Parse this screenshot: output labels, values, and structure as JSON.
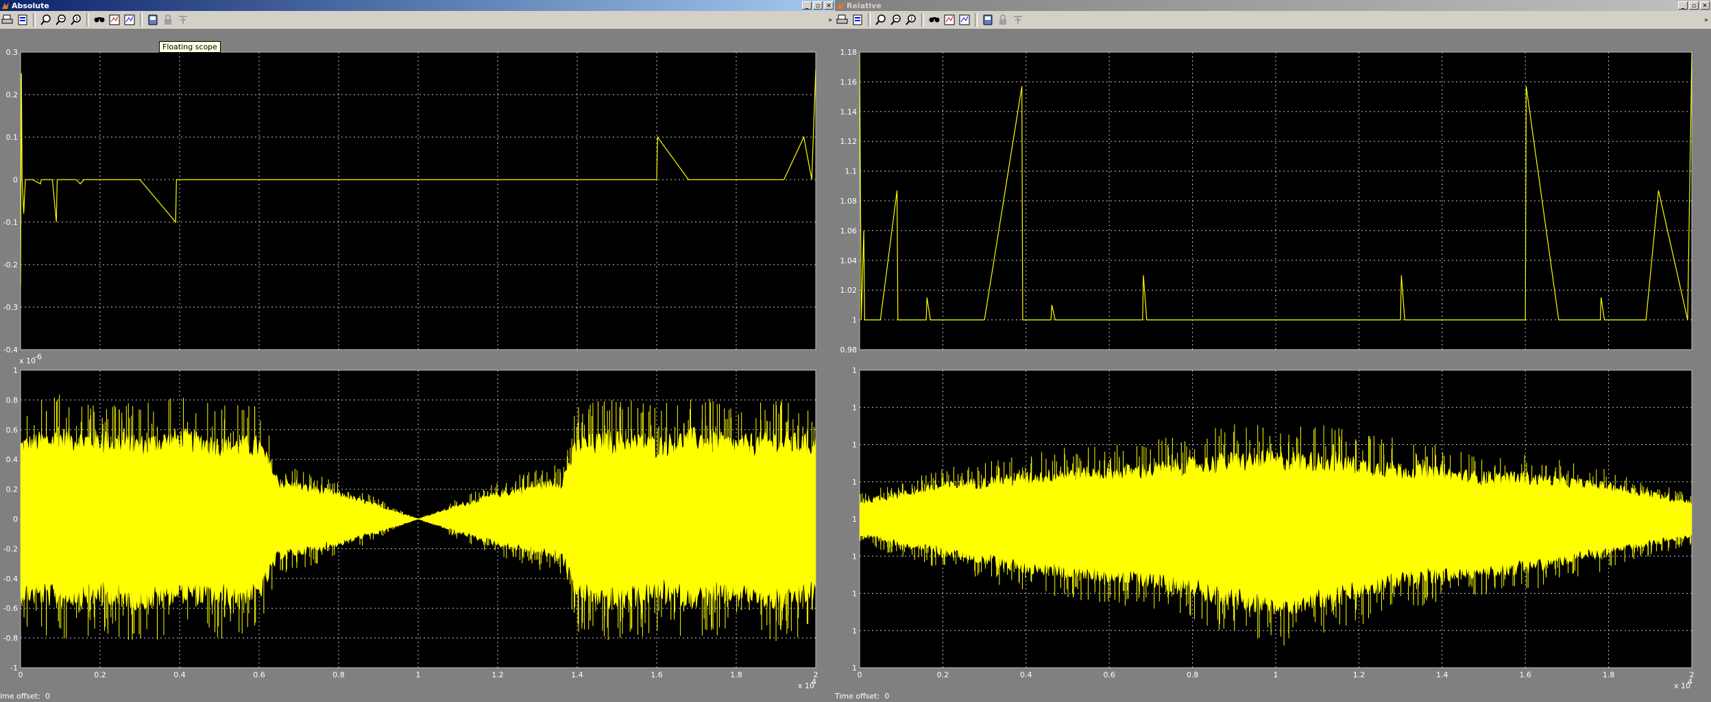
{
  "windows": [
    {
      "title": "Absolute",
      "status_label": "ime offset:",
      "status_value": "0",
      "tooltip": "Floating scope",
      "axes": [
        {
          "yticks": [
            "0.3",
            "0.2",
            "0.1",
            "0",
            "-0.1",
            "-0.2",
            "-0.3",
            "-0.4"
          ],
          "ylim": [
            -0.4,
            0.3
          ],
          "xticks": [],
          "exponent": "",
          "signal_color": "#ffff00",
          "chart_data": {
            "type": "line",
            "xlim": [
              0,
              2
            ],
            "ylim": [
              -0.4,
              0.3
            ],
            "x": [
              0,
              0.002,
              0.004,
              0.008,
              0.012,
              0.02,
              0.03,
              0.05,
              0.052,
              0.06,
              0.08,
              0.09,
              0.092,
              0.1,
              0.14,
              0.15,
              0.16,
              0.3,
              0.39,
              0.392,
              0.4,
              0.46,
              0.7,
              1.3,
              1.6,
              1.602,
              1.68,
              1.7,
              1.92,
              1.97,
              1.99,
              2.0
            ],
            "y": [
              -0.25,
              0.25,
              0,
              -0.08,
              0,
              0,
              0,
              -0.01,
              0,
              0,
              0,
              -0.1,
              0,
              0,
              0,
              -0.01,
              0,
              0,
              -0.1,
              0,
              0,
              0,
              0,
              0,
              0,
              0.1,
              0,
              0,
              0,
              0.1,
              0,
              0.26
            ],
            "grid": true
          }
        },
        {
          "yticks": [
            "1",
            "0.8",
            "0.6",
            "0.4",
            "0.2",
            "0",
            "-0.2",
            "-0.4",
            "-0.6",
            "-0.8",
            "-1"
          ],
          "ylim": [
            -1,
            1
          ],
          "xticks": [
            "0",
            "0.2",
            "0.4",
            "0.6",
            "0.8",
            "1",
            "1.2",
            "1.4",
            "1.6",
            "1.8",
            "2"
          ],
          "exponent": "x 10",
          "exponent_top": "-6",
          "xexp": "4",
          "signal_color": "#ffff00",
          "chart_data": {
            "type": "area",
            "xlim": [
              0,
              2
            ],
            "ylim": [
              -1,
              1
            ],
            "x": [
              0,
              0.1,
              0.2,
              0.3,
              0.4,
              0.5,
              0.6,
              0.65,
              0.7,
              0.8,
              0.9,
              1.0,
              1.1,
              1.2,
              1.3,
              1.36,
              1.4,
              1.5,
              1.6,
              1.7,
              1.8,
              1.9,
              2.0
            ],
            "upper": [
              0.45,
              0.5,
              0.48,
              0.45,
              0.5,
              0.45,
              0.45,
              0.22,
              0.2,
              0.15,
              0.08,
              0.0,
              0.08,
              0.15,
              0.2,
              0.22,
              0.45,
              0.48,
              0.45,
              0.5,
              0.45,
              0.48,
              0.45
            ],
            "lower": [
              -0.45,
              -0.48,
              -0.45,
              -0.5,
              -0.45,
              -0.48,
              -0.45,
              -0.22,
              -0.2,
              -0.15,
              -0.08,
              0.0,
              -0.08,
              -0.15,
              -0.2,
              -0.22,
              -0.45,
              -0.5,
              -0.45,
              -0.48,
              -0.45,
              -0.5,
              -0.45
            ],
            "grid": true
          }
        }
      ]
    },
    {
      "title": "Relative",
      "status_label": "Time offset:",
      "status_value": "0",
      "axes": [
        {
          "yticks": [
            "1.18",
            "1.16",
            "1.14",
            "1.12",
            "1.1",
            "1.08",
            "1.06",
            "1.04",
            "1.02",
            "1",
            "0.98"
          ],
          "ylim": [
            0.98,
            1.18
          ],
          "xticks": [],
          "exponent": "",
          "signal_color": "#ffff00",
          "chart_data": {
            "type": "line",
            "xlim": [
              0,
              2
            ],
            "ylim": [
              0.98,
              1.18
            ],
            "x": [
              0,
              0.004,
              0.01,
              0.012,
              0.05,
              0.09,
              0.092,
              0.1,
              0.16,
              0.162,
              0.17,
              0.3,
              0.39,
              0.392,
              0.4,
              0.46,
              0.462,
              0.47,
              0.68,
              0.682,
              0.69,
              1.3,
              1.302,
              1.31,
              1.6,
              1.602,
              1.68,
              1.78,
              1.782,
              1.79,
              1.89,
              1.92,
              1.99,
              2.0
            ],
            "y": [
              1.18,
              1.0,
              1.06,
              1.0,
              1.0,
              1.087,
              1.0,
              1.0,
              1.0,
              1.015,
              1.0,
              1.0,
              1.157,
              1.0,
              1.0,
              1.0,
              1.01,
              1.0,
              1.0,
              1.03,
              1.0,
              1.0,
              1.03,
              1.0,
              1.0,
              1.157,
              1.0,
              1.0,
              1.015,
              1.0,
              1.0,
              1.087,
              1.0,
              1.18
            ],
            "grid": true
          }
        },
        {
          "yticks": [
            "1",
            "1",
            "1",
            "1",
            "1",
            "1",
            "1",
            "1",
            "1"
          ],
          "ylim": [
            0,
            8
          ],
          "xticks": [
            "0",
            "0.2",
            "0.4",
            "0.6",
            "0.8",
            "1",
            "1.2",
            "1.4",
            "1.6",
            "1.8",
            "2"
          ],
          "exponent": "x 10",
          "xexp": "4",
          "signal_color": "#ffff00",
          "chart_data": {
            "type": "area",
            "xlim": [
              0,
              2
            ],
            "ylim": [
              0,
              8
            ],
            "x": [
              0,
              0.1,
              0.2,
              0.3,
              0.4,
              0.5,
              0.6,
              0.7,
              0.8,
              0.9,
              1.0,
              1.1,
              1.2,
              1.3,
              1.4,
              1.5,
              1.6,
              1.7,
              1.8,
              1.9,
              2.0
            ],
            "upper": [
              4.4,
              4.6,
              4.8,
              4.9,
              5.0,
              5.1,
              5.1,
              5.2,
              5.3,
              5.4,
              5.4,
              5.4,
              5.3,
              5.2,
              5.1,
              5.0,
              5.0,
              4.9,
              4.8,
              4.6,
              4.4
            ],
            "lower": [
              3.6,
              3.4,
              3.2,
              3.0,
              2.8,
              2.7,
              2.6,
              2.5,
              2.3,
              2.0,
              1.8,
              2.0,
              2.2,
              2.5,
              2.6,
              2.7,
              2.8,
              3.0,
              3.2,
              3.4,
              3.6
            ],
            "grid": true
          }
        }
      ]
    }
  ],
  "icons": {
    "toolbar": [
      "print-icon",
      "params-icon",
      "zoom-icon",
      "zoom-x-icon",
      "zoom-y-icon",
      "autoscale-icon",
      "save-axes-icon",
      "restore-axes-icon",
      "floating-scope-icon",
      "lock-icon",
      "signal-selection-icon"
    ]
  },
  "colors": {
    "plot_bg": "#000000",
    "frame": "#808080",
    "grid": "#ffffff",
    "signal": "#ffff00"
  }
}
